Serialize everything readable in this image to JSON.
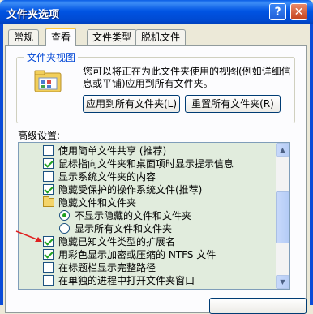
{
  "window": {
    "title": "文件夹选项"
  },
  "titlebar_buttons": {
    "help": "?",
    "close": "✕"
  },
  "tabs": [
    {
      "label": "常规",
      "active": false
    },
    {
      "label": "查看",
      "active": true
    },
    {
      "label": "文件类型",
      "active": false
    },
    {
      "label": "脱机文件",
      "active": false
    }
  ],
  "folder_views": {
    "group_label": "文件夹视图",
    "description": "您可以将正在为此文件夹使用的视图(例如详细信息或平铺)应用到所有文件夹。",
    "apply_button": "应用到所有文件夹(L)",
    "reset_button": "重置所有文件夹(R)"
  },
  "advanced": {
    "label": "高级设置:",
    "items": [
      {
        "type": "checkbox",
        "label": "使用简单文件共享 (推荐)",
        "checked": false,
        "indent": 0
      },
      {
        "type": "checkbox",
        "label": "鼠标指向文件夹和桌面项时显示提示信息",
        "checked": true,
        "indent": 0
      },
      {
        "type": "checkbox",
        "label": "显示系统文件夹的内容",
        "checked": false,
        "indent": 0
      },
      {
        "type": "checkbox",
        "label": "隐藏受保护的操作系统文件(推荐)",
        "checked": true,
        "indent": 0
      },
      {
        "type": "folder",
        "label": "隐藏文件和文件夹",
        "indent": 0
      },
      {
        "type": "radio",
        "label": "不显示隐藏的文件和文件夹",
        "checked": true,
        "indent": 1
      },
      {
        "type": "radio",
        "label": "显示所有文件和文件夹",
        "checked": false,
        "indent": 1
      },
      {
        "type": "checkbox",
        "label": "隐藏已知文件类型的扩展名",
        "checked": true,
        "indent": 0
      },
      {
        "type": "checkbox",
        "label": "用彩色显示加密或压缩的 NTFS 文件",
        "checked": true,
        "indent": 0
      },
      {
        "type": "checkbox",
        "label": "在标题栏显示完整路径",
        "checked": false,
        "indent": 0
      },
      {
        "type": "checkbox",
        "label": "在单独的进程中打开文件夹窗口",
        "checked": false,
        "indent": 0
      }
    ]
  },
  "colors": {
    "accent": "#0054e3",
    "list_bg": "#e1ecdd",
    "annotation_arrow": "#e02020"
  }
}
